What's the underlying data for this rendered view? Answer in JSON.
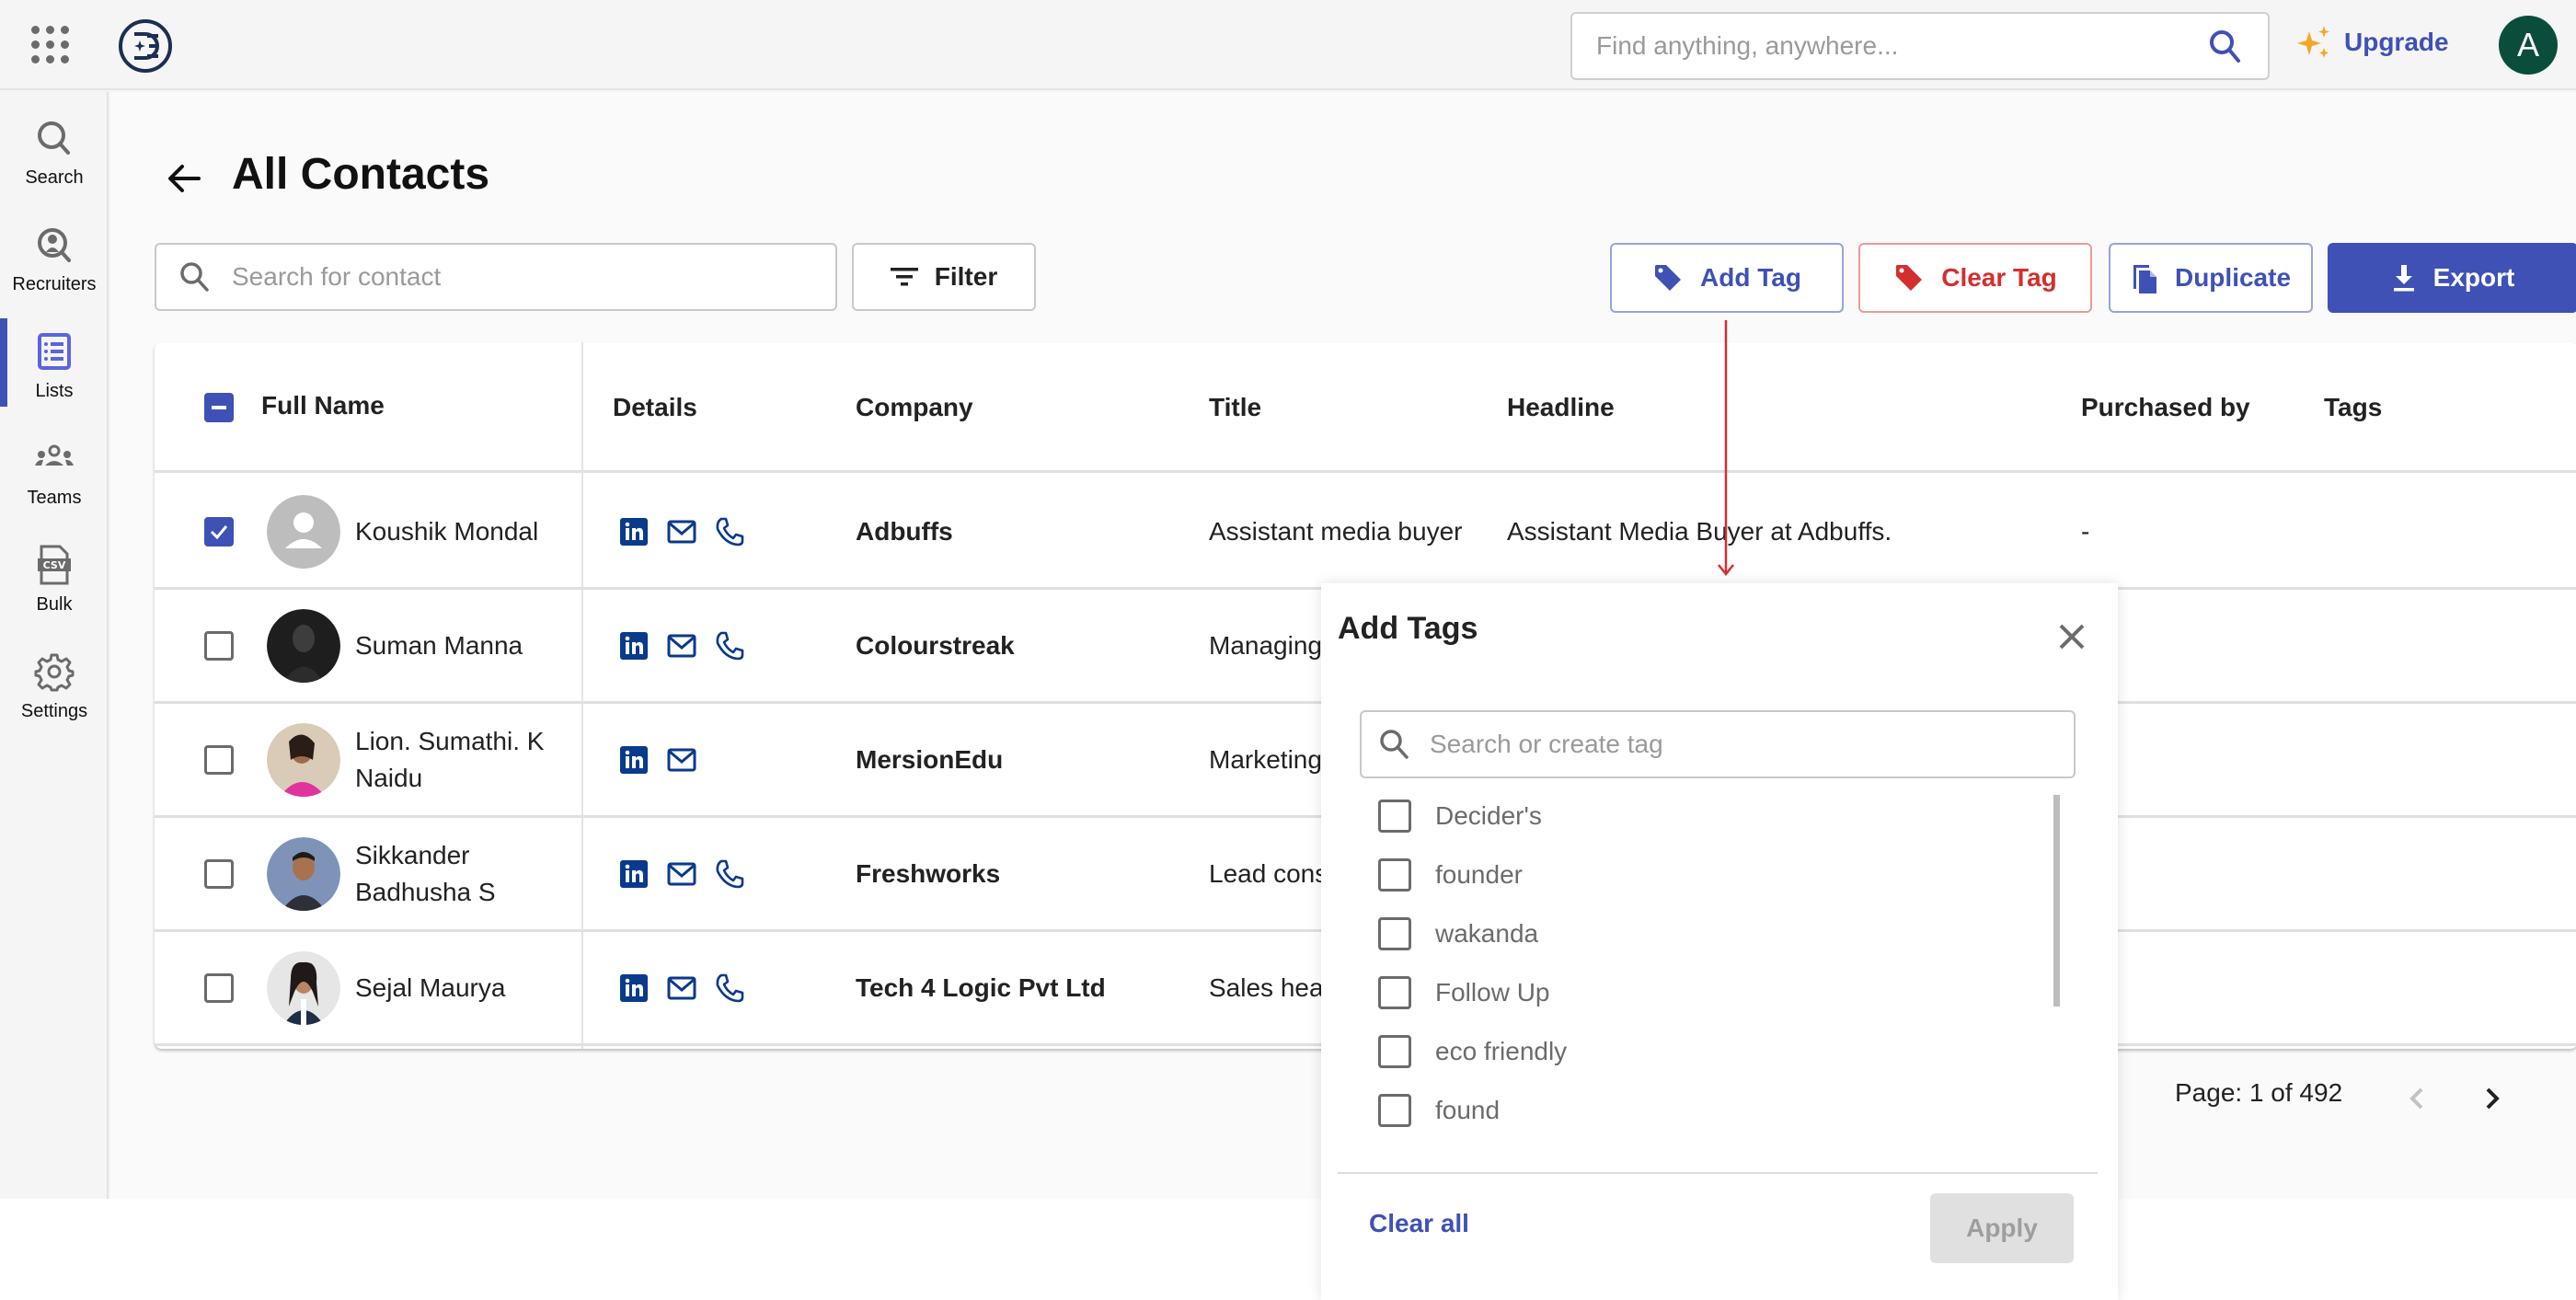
{
  "topbar": {
    "search_placeholder": "Find anything, anywhere...",
    "upgrade_label": "Upgrade",
    "avatar_initial": "A"
  },
  "sidebar": {
    "items": [
      {
        "label": "Search",
        "icon": "search-icon",
        "active": false
      },
      {
        "label": "Recruiters",
        "icon": "recruiter-search-icon",
        "active": false
      },
      {
        "label": "Lists",
        "icon": "list-icon",
        "active": true
      },
      {
        "label": "Teams",
        "icon": "teams-icon",
        "active": false
      },
      {
        "label": "Bulk",
        "icon": "csv-file-icon",
        "active": false
      },
      {
        "label": "Settings",
        "icon": "gear-icon",
        "active": false
      }
    ]
  },
  "page": {
    "title": "All Contacts",
    "search_placeholder": "Search for contact",
    "filter_label": "Filter",
    "actions": {
      "add_tag": "Add Tag",
      "clear_tag": "Clear Tag",
      "duplicate": "Duplicate",
      "export": "Export"
    }
  },
  "colors": {
    "primary": "#3f51b5",
    "danger": "#d32f2f",
    "avatar_bg": "#0b4d3b",
    "upgrade_star": "#f5a623",
    "detail_icon": "#0a3a8c",
    "annotation_arrow": "#d32f2f"
  },
  "table": {
    "columns": [
      "Full Name",
      "Details",
      "Company",
      "Title",
      "Headline",
      "Purchased by",
      "Tags"
    ],
    "header_checkbox": "indeterminate",
    "rows": [
      {
        "checked": true,
        "name": "Koushik Mondal",
        "avatar": "placeholder",
        "details": [
          "linkedin",
          "email",
          "phone"
        ],
        "company": "Adbuffs",
        "title": "Assistant media buyer",
        "headline": "Assistant Media Buyer at Adbuffs.",
        "purchased_by": "-",
        "tags": ""
      },
      {
        "checked": false,
        "name": "Suman Manna",
        "avatar": "photo",
        "details": [
          "linkedin",
          "email",
          "phone"
        ],
        "company": "Colourstreak",
        "title": "Managing",
        "headline": "",
        "purchased_by": "",
        "tags": ""
      },
      {
        "checked": false,
        "name": "Lion. Sumathi. K Naidu",
        "avatar": "photo",
        "details": [
          "linkedin",
          "email"
        ],
        "company": "MersionEdu",
        "title": "Marketing",
        "headline": "",
        "purchased_by": "",
        "tags": ""
      },
      {
        "checked": false,
        "name": "Sikkander Badhusha S",
        "avatar": "photo",
        "details": [
          "linkedin",
          "email",
          "phone"
        ],
        "company": "Freshworks",
        "title": "Lead cons process e",
        "headline": "",
        "purchased_by": "",
        "tags": ""
      },
      {
        "checked": false,
        "name": "Sejal Maurya",
        "avatar": "photo",
        "details": [
          "linkedin",
          "email",
          "phone"
        ],
        "company": "Tech 4 Logic Pvt Ltd",
        "title": "Sales hea india",
        "headline": "",
        "purchased_by": "",
        "tags": ""
      }
    ]
  },
  "pagination": {
    "label": "Page: 1 of 492",
    "current": 1,
    "total": 492,
    "prev_enabled": false,
    "next_enabled": true
  },
  "modal": {
    "title": "Add Tags",
    "search_placeholder": "Search or create tag",
    "tags": [
      {
        "label": "Decider's",
        "checked": false
      },
      {
        "label": "founder",
        "checked": false
      },
      {
        "label": "wakanda",
        "checked": false
      },
      {
        "label": "Follow Up",
        "checked": false
      },
      {
        "label": "eco friendly",
        "checked": false
      },
      {
        "label": "found",
        "checked": false
      }
    ],
    "clear_all_label": "Clear all",
    "apply_label": "Apply",
    "apply_enabled": false
  }
}
